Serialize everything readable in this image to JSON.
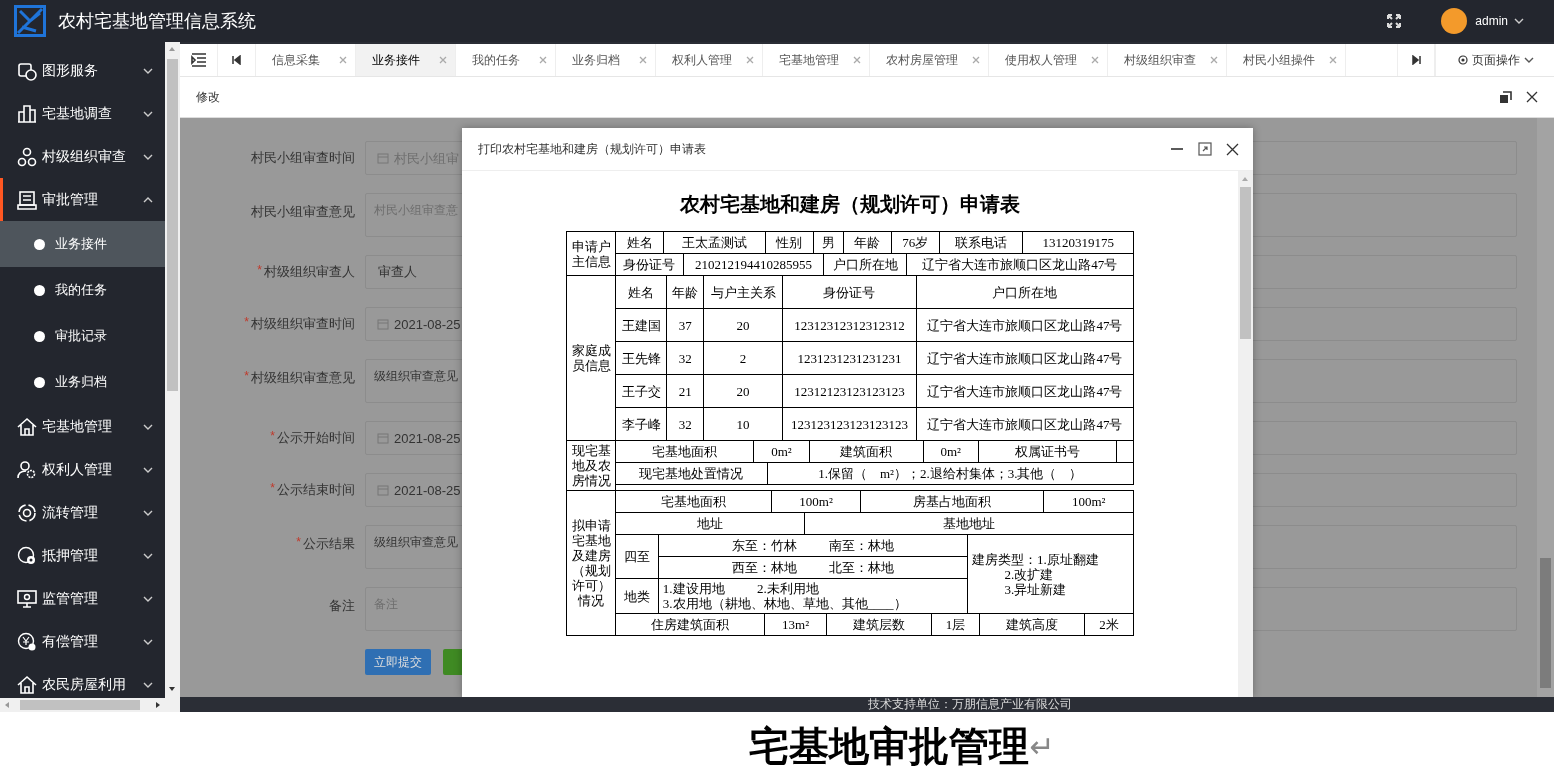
{
  "header": {
    "title": "农村宅基地管理信息系统",
    "user": "admin"
  },
  "sidebar": {
    "items": [
      {
        "label": "图形服务",
        "expanded": false,
        "selected": false
      },
      {
        "label": "宅基地调查",
        "expanded": false,
        "selected": false
      },
      {
        "label": "村级组织审查",
        "expanded": false,
        "selected": false
      },
      {
        "label": "审批管理",
        "expanded": true,
        "selected": true,
        "children": [
          {
            "label": "业务接件",
            "selected": true
          },
          {
            "label": "我的任务",
            "selected": false
          },
          {
            "label": "审批记录",
            "selected": false
          },
          {
            "label": "业务归档",
            "selected": false
          }
        ]
      },
      {
        "label": "宅基地管理",
        "expanded": false,
        "selected": false
      },
      {
        "label": "权利人管理",
        "expanded": false,
        "selected": false
      },
      {
        "label": "流转管理",
        "expanded": false,
        "selected": false
      },
      {
        "label": "抵押管理",
        "expanded": false,
        "selected": false
      },
      {
        "label": "监管管理",
        "expanded": false,
        "selected": false
      },
      {
        "label": "有偿管理",
        "expanded": false,
        "selected": false
      },
      {
        "label": "农民房屋利用",
        "expanded": false,
        "selected": false
      }
    ]
  },
  "tabs": [
    {
      "label": "信息采集",
      "selected": false
    },
    {
      "label": "业务接件",
      "selected": true
    },
    {
      "label": "我的任务",
      "selected": false
    },
    {
      "label": "业务归档",
      "selected": false
    },
    {
      "label": "权利人管理",
      "selected": false
    },
    {
      "label": "宅基地管理",
      "selected": false
    },
    {
      "label": "农村房屋管理",
      "selected": false
    },
    {
      "label": "使用权人管理",
      "selected": false
    },
    {
      "label": "村级组织审查",
      "selected": false
    },
    {
      "label": "村民小组操件",
      "selected": false
    }
  ],
  "page_actions": {
    "label": "页面操作"
  },
  "panel": {
    "title": "修改"
  },
  "form": {
    "fields": [
      {
        "label": "村民小组审查时间",
        "kind": "date",
        "placeholder": "村民小组审"
      },
      {
        "label": "村民小组审查意见",
        "kind": "textarea",
        "placeholder": "村民小组审查意"
      },
      {
        "marker": "*",
        "label": "村级组织审查人",
        "kind": "text",
        "value": "审查人"
      },
      {
        "marker": "*",
        "label": "村级组织审查时间",
        "kind": "date",
        "value": "2021-08-25"
      },
      {
        "marker": "*",
        "label": "村级组织审查意见",
        "kind": "textarea",
        "value": "级组织审查意见"
      },
      {
        "marker": "*",
        "label": "公示开始时间",
        "kind": "date",
        "value": "2021-08-25"
      },
      {
        "marker": "*",
        "label": "公示结束时间",
        "kind": "date",
        "value": "2021-08-25"
      },
      {
        "marker": "*",
        "label": "公示结果",
        "kind": "textarea",
        "value": "级组织审查意见"
      },
      {
        "label": "备注",
        "kind": "textarea",
        "placeholder": "备注"
      }
    ],
    "buttons": [
      {
        "label": "立即提交",
        "kind": "primary"
      },
      {
        "kind": "success"
      }
    ]
  },
  "dialog": {
    "title": "打印农村宅基地和建房（规划许可）申请表",
    "heading": "农村宅基地和建房（规划许可）申请表",
    "sections": [
      {
        "label": "申请户主信息",
        "groups": [
          {
            "rows": [
              [
                "姓名",
                "王太孟测试",
                "性别",
                "男",
                "年龄",
                "76岁",
                "联系电话",
                "13120319175"
              ]
            ]
          },
          {
            "rows": [
              [
                "身份证号",
                "210212194410285955",
                "户口所在地",
                "辽宁省大连市旅顺口区龙山路47号"
              ]
            ]
          }
        ]
      },
      {
        "label": "家庭成员信息",
        "groups": [
          {
            "rows": [
              [
                "姓名",
                "年龄",
                "与户主关系",
                "身份证号",
                "户口所在地"
              ],
              [
                "王建国",
                "37",
                "20",
                "12312312312312312",
                "辽宁省大连市旅顺口区龙山路47号"
              ],
              [
                "王先锋",
                "32",
                "2",
                "1231231231231231",
                "辽宁省大连市旅顺口区龙山路47号"
              ],
              [
                "王子交",
                "21",
                "20",
                "12312123123123123",
                "辽宁省大连市旅顺口区龙山路47号"
              ],
              [
                "李子峰",
                "32",
                "10",
                "123123123123123123",
                "辽宁省大连市旅顺口区龙山路47号"
              ]
            ]
          }
        ]
      },
      {
        "label": "现宅基地及农房情况",
        "groups": [
          {
            "rows": [
              [
                "宅基地面积",
                "0m²",
                "建筑面积",
                "0m²",
                "权属证书号",
                null
              ]
            ]
          },
          {
            "rows": [
              [
                "现宅基地处置情况",
                "1.保留（　m²）；2.退给村集体；3.其他（　）"
              ]
            ]
          }
        ]
      },
      {
        "label": "拟申请宅基地及建房（规划许可）情况",
        "groups": [
          {
            "rows": [
              [
                "宅基地面积",
                "100m²",
                "房基占地面积",
                "100m²"
              ]
            ]
          },
          {
            "rows": [
              [
                "地址",
                "基地地址"
              ]
            ]
          },
          {
            "rows": [
              [
                {
                  "text": "四至",
                  "rowspan": 2
                },
                "东至：竹林          南至：林地",
                {
                  "text": "建房类型：1.原址翻建\n          2.改扩建\n          3.异址新建",
                  "rowspan": 3
                }
              ],
              [
                "西至：林地          北至：林地"
              ],
              [
                "地类",
                "1.建设用地          2.未利用地\n3.农用地（耕地、林地、草地、其他____）"
              ]
            ]
          },
          {
            "rows": [
              [
                "住房建筑面积",
                "13m²",
                "建筑层数",
                "1层",
                "建筑高度",
                "2米"
              ]
            ]
          }
        ]
      }
    ]
  },
  "footer": {
    "text": "技术支持单位：万朋信息产业有限公司"
  },
  "caption": {
    "text": "宅基地审批管理",
    "mark": "↵"
  }
}
